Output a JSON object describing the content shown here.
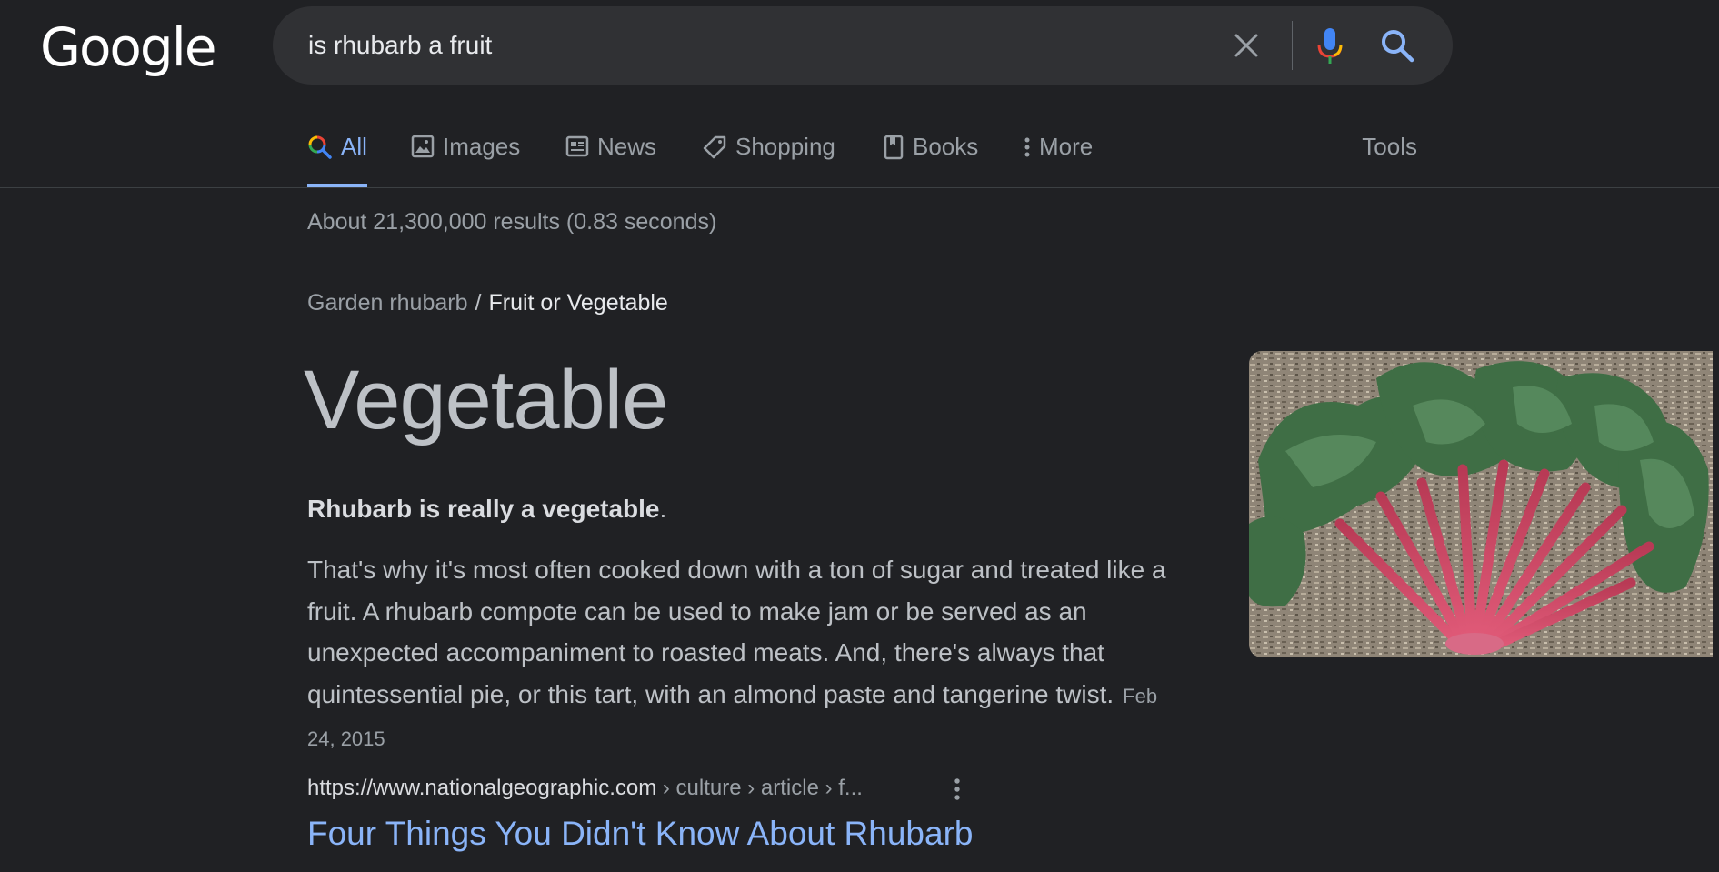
{
  "header": {
    "logo_text": "Google",
    "search": {
      "value": "is rhubarb a fruit"
    },
    "icons": {
      "clear": "close-icon",
      "mic": "microphone-icon",
      "search": "search-icon"
    }
  },
  "tabs": [
    {
      "label": "All",
      "active": true,
      "icon": "search-icon"
    },
    {
      "label": "Images",
      "active": false,
      "icon": "image-icon"
    },
    {
      "label": "News",
      "active": false,
      "icon": "news-icon"
    },
    {
      "label": "Shopping",
      "active": false,
      "icon": "tag-icon"
    },
    {
      "label": "Books",
      "active": false,
      "icon": "book-icon"
    },
    {
      "label": "More",
      "active": false,
      "icon": "more-vertical-icon"
    }
  ],
  "tools_label": "Tools",
  "result_stats": "About 21,300,000 results (0.83 seconds)",
  "featured": {
    "breadcrumb_parent": "Garden rhubarb",
    "breadcrumb_separator": "/",
    "breadcrumb_current": "Fruit or Vegetable",
    "answer": "Vegetable",
    "lead_bold": "Rhubarb is really a vegetable",
    "lead_end": ".",
    "body": "That's why it's most often cooked down with a ton of sugar and treated like a fruit. A rhubarb compote can be used to make jam or be served as an unexpected accompaniment to roasted meats. And, there's always that quintessential pie, or this tart, with an almond paste and tangerine twist.",
    "date": "Feb 24, 2015",
    "source_domain": "https://www.nationalgeographic.com",
    "source_path": " › culture › article › f...",
    "title": "Four Things You Didn't Know About Rhubarb",
    "image_subject": "rhubarb stalks with leaves on wood chips"
  },
  "colors": {
    "background": "#202124",
    "search_box": "#303134",
    "link": "#8ab4f8",
    "text": "#bdc1c6",
    "muted": "#9aa0a6"
  }
}
